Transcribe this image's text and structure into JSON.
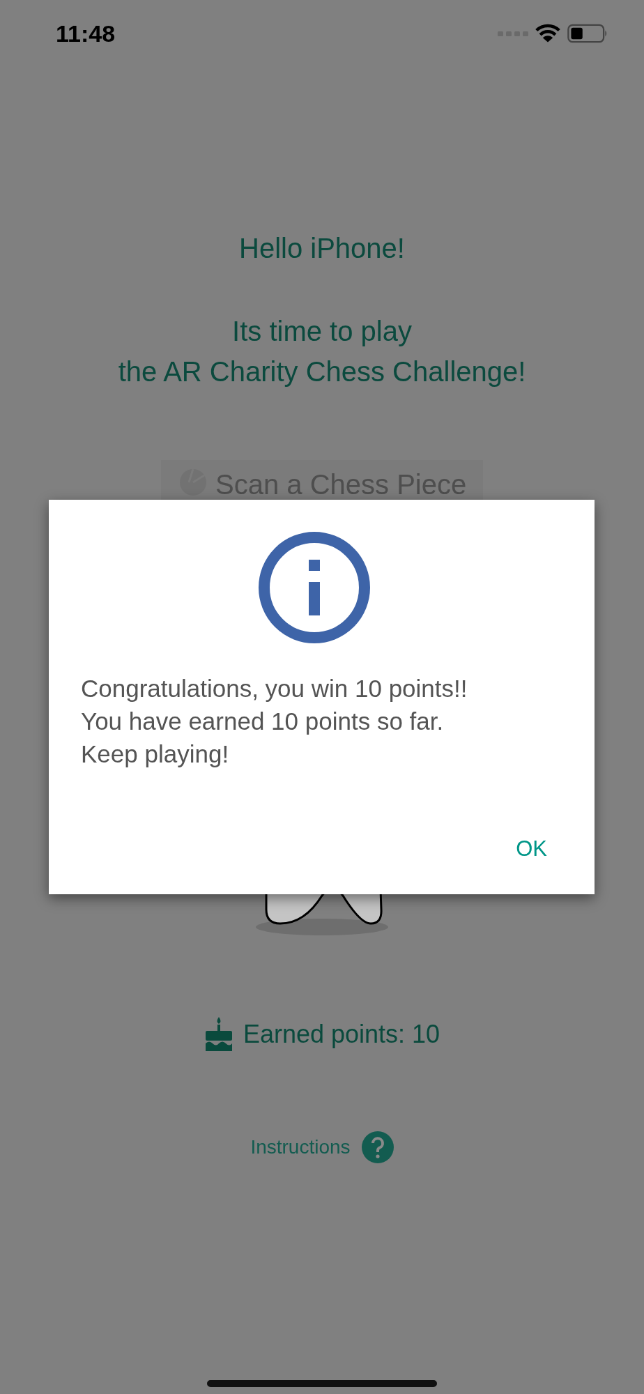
{
  "status_bar": {
    "time": "11:48"
  },
  "greeting": "Hello iPhone!",
  "subtitle": "Its time to play\nthe AR Charity Chess Challenge!",
  "scan_button": {
    "label": "Scan a Chess Piece"
  },
  "earned_points": "Earned points: 10",
  "instructions_link": "Instructions",
  "dialog": {
    "message": "Congratulations, you win 10 points!!\nYou have earned 10 points so far.\nKeep playing!",
    "buttons": [
      "OK"
    ]
  }
}
